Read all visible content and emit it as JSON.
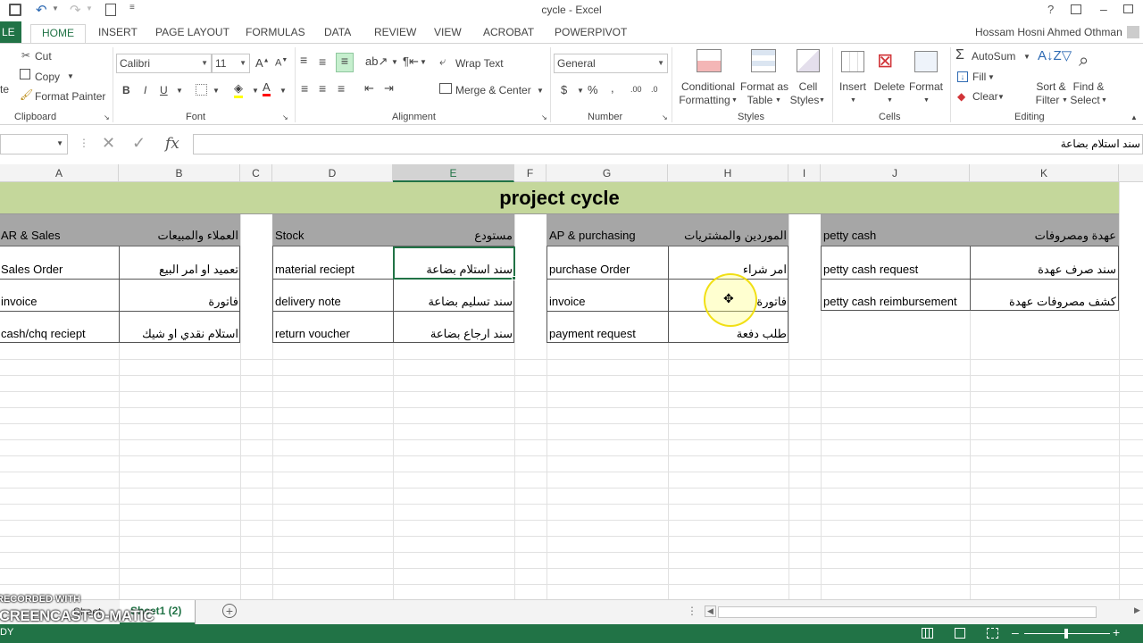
{
  "window": {
    "title": "cycle - Excel",
    "user": "Hossam Hosni Ahmed Othman"
  },
  "tabs": [
    "FILE",
    "HOME",
    "INSERT",
    "PAGE LAYOUT",
    "FORMULAS",
    "DATA",
    "REVIEW",
    "VIEW",
    "ACROBAT",
    "POWERPIVOT"
  ],
  "file_tab_visible": "LE",
  "ribbon": {
    "clipboard": {
      "cut": "Cut",
      "copy": "Copy",
      "format_painter": "Format Painter",
      "label": "Clipboard",
      "paste_partial": "te"
    },
    "font": {
      "name": "Calibri",
      "size": "11",
      "bold": "B",
      "italic": "I",
      "underline": "U",
      "label": "Font"
    },
    "alignment": {
      "wrap": "Wrap Text",
      "merge": "Merge & Center",
      "label": "Alignment"
    },
    "number": {
      "format": "General",
      "currency": "$",
      "percent": "%",
      "comma": ",",
      "label": "Number"
    },
    "styles": {
      "cond1": "Conditional",
      "cond2": "Formatting",
      "fmt1": "Format as",
      "fmt2": "Table",
      "cell1": "Cell",
      "cell2": "Styles",
      "label": "Styles"
    },
    "cells": {
      "insert": "Insert",
      "delete": "Delete",
      "format": "Format",
      "label": "Cells"
    },
    "editing": {
      "autosum": "AutoSum",
      "fill": "Fill",
      "clear": "Clear",
      "sort1": "Sort &",
      "sort2": "Filter",
      "find1": "Find &",
      "find2": "Select",
      "label": "Editing"
    }
  },
  "formula_bar": {
    "fx": "fx",
    "content": "سند استلام بضاعة"
  },
  "columns": [
    "A",
    "B",
    "C",
    "D",
    "E",
    "F",
    "G",
    "H",
    "I",
    "J",
    "K"
  ],
  "selected_column": "E",
  "sheet": {
    "title": "project cycle",
    "header": {
      "ar_sales_en": "AR & Sales",
      "ar_sales_ar": "العملاء والمبيعات",
      "stock_en": "Stock",
      "stock_ar": "مستودع",
      "ap_en": "AP & purchasing",
      "ap_ar": "الموردين والمشتريات",
      "petty_en": "petty cash",
      "petty_ar": "عهدة ومصروفات"
    },
    "rows": [
      {
        "a": "Sales Order",
        "b": "تعميد او امر البيع",
        "d": "material reciept",
        "e": "سند استلام بضاعة",
        "g": "purchase Order",
        "h": "امر شراء",
        "j": "petty cash request",
        "k": "سند صرف عهدة"
      },
      {
        "a": "invoice",
        "b": "فاتورة",
        "d": "delivery note",
        "e": "سند تسليم بضاعة",
        "g": "invoice",
        "h": "فاتورة",
        "j": "petty cash reimbursement",
        "k": "كشف مصروفات عهدة"
      },
      {
        "a": "cash/chq reciept",
        "b": "استلام نقدي او شيك",
        "d": "return voucher",
        "e": "سند ارجاع بضاعة",
        "g": "payment request",
        "h": "طلب دفعة",
        "j": "",
        "k": ""
      }
    ]
  },
  "sheet_tabs": {
    "sheet1": "Sheet",
    "sheet2": "Sheet1 (2)"
  },
  "watermark": {
    "line1": "RECORDED WITH",
    "line2": "SCREENCAST-O-MATIC"
  },
  "status": {
    "ready": "DY"
  },
  "colors": {
    "excel_green": "#217346",
    "title_bg": "#c4d79b",
    "header_bg": "#a6a6a6"
  }
}
